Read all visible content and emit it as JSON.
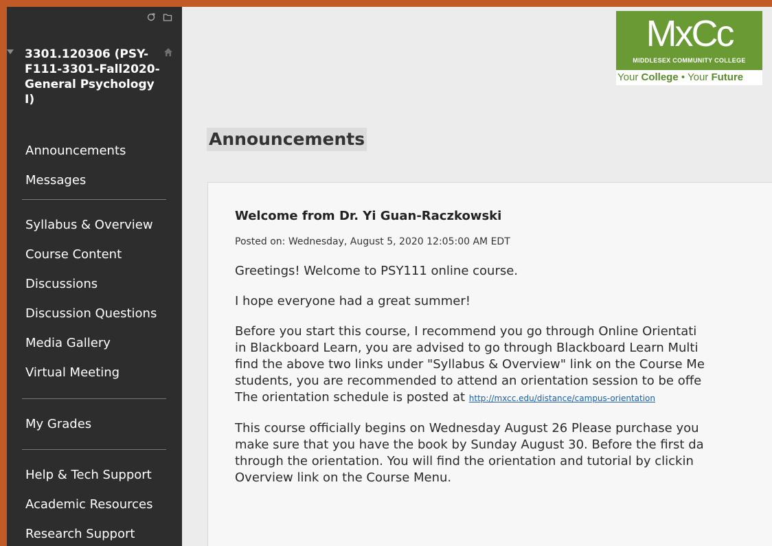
{
  "sidebar": {
    "course_title": "3301.120306 (PSY-F111-3301-Fall2020-General Psychology I)",
    "groups": [
      [
        "Announcements",
        "Messages"
      ],
      [
        "Syllabus & Overview",
        "Course Content",
        "Discussions",
        "Discussion Questions",
        "Media Gallery",
        "Virtual Meeting"
      ],
      [
        "My Grades"
      ],
      [
        "Help & Tech Support",
        "Academic Resources",
        "Research Support"
      ]
    ],
    "icons": {
      "refresh": "refresh-icon",
      "folder": "folder-icon",
      "home": "home-icon",
      "collapse": "caret-down-icon"
    }
  },
  "logo": {
    "mark": "MxCc",
    "college": "MIDDLESEX COMMUNITY COLLEGE",
    "tagline": [
      "Your ",
      "College",
      " • Your ",
      "Future"
    ]
  },
  "main": {
    "page_title": "Announcements",
    "announcement": {
      "title": "Welcome from Dr. Yi Guan-Raczkowski",
      "posted": "Posted on: Wednesday, August 5, 2020 12:05:00 AM EDT",
      "paragraphs": [
        [
          "Greetings! Welcome to PSY111 online course."
        ],
        [
          "I hope everyone had a great summer!"
        ],
        [
          "Before you start this course, I recommend you go through Online Orientati",
          "in Blackboard Learn, you are advised to go through Blackboard Learn Multi",
          "find the above two links under \"Syllabus & Overview\" link on the Course Me",
          "students, you are recommended to attend an orientation session to be offe",
          "The orientation schedule is posted at "
        ],
        [
          "This course officially begins on Wednesday August 26  Please purchase you",
          "make sure that you have the book by Sunday August 30. Before the first da",
          "through the orientation.  You will find the orientation and tutorial by clickin",
          "Overview link on the Course Menu."
        ]
      ],
      "orientation_link": "http://mxcc.edu/distance/campus-orientation"
    }
  },
  "colors": {
    "frame": "#c25a28",
    "sidebar_bg": "#2d2d2d",
    "logo_green": "#6a9a34",
    "link": "#1a5fa8"
  }
}
